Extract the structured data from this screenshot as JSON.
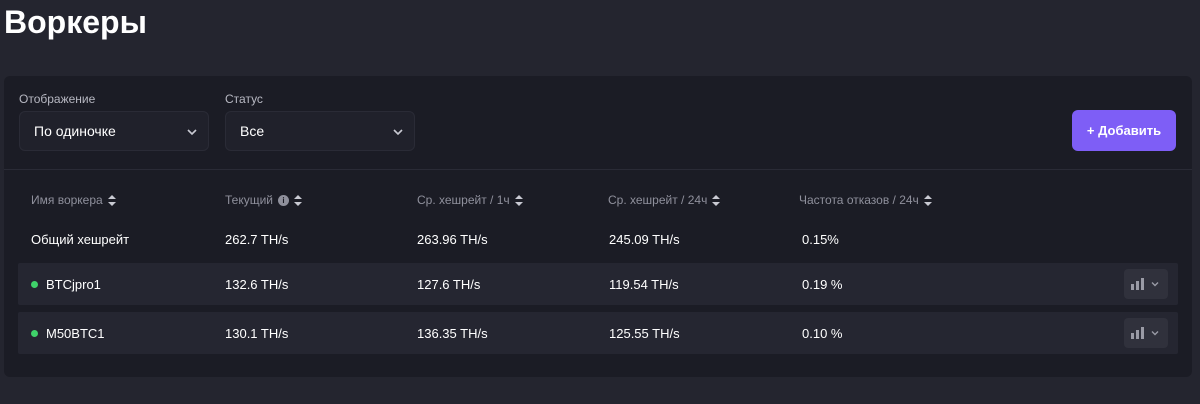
{
  "page": {
    "title": "Воркеры"
  },
  "filters": {
    "display": {
      "label": "Отображение",
      "value": "По одиночке"
    },
    "status": {
      "label": "Статус",
      "value": "Все"
    },
    "add_label": "+ Добавить"
  },
  "table": {
    "columns": [
      "Имя воркера",
      "Текущий",
      "Ср. хешрейт / 1ч",
      "Ср. хешрейт / 24ч",
      "Частота отказов / 24ч"
    ],
    "total": {
      "name": "Общий хешрейт",
      "current": "262.7 TH/s",
      "avg_1h": "263.96 TH/s",
      "avg_24h": "245.09 TH/s",
      "reject": "0.15%"
    },
    "rows": [
      {
        "name": "BTCjpro1",
        "status_color": "#3fd26a",
        "current": "132.6 TH/s",
        "avg_1h": "127.6 TH/s",
        "avg_24h": "119.54 TH/s",
        "reject": "0.19 %"
      },
      {
        "name": "M50BTC1",
        "status_color": "#3fd26a",
        "current": "130.1 TH/s",
        "avg_1h": "136.35 TH/s",
        "avg_24h": "125.55 TH/s",
        "reject": "0.10 %"
      }
    ]
  },
  "colors": {
    "accent": "#7e5ef6",
    "online": "#3fd26a",
    "panel": "#1b1c25",
    "background": "#24252f"
  },
  "icons": [
    "chevron-down-icon",
    "sort-icon",
    "info-icon",
    "bar-chart-icon"
  ]
}
